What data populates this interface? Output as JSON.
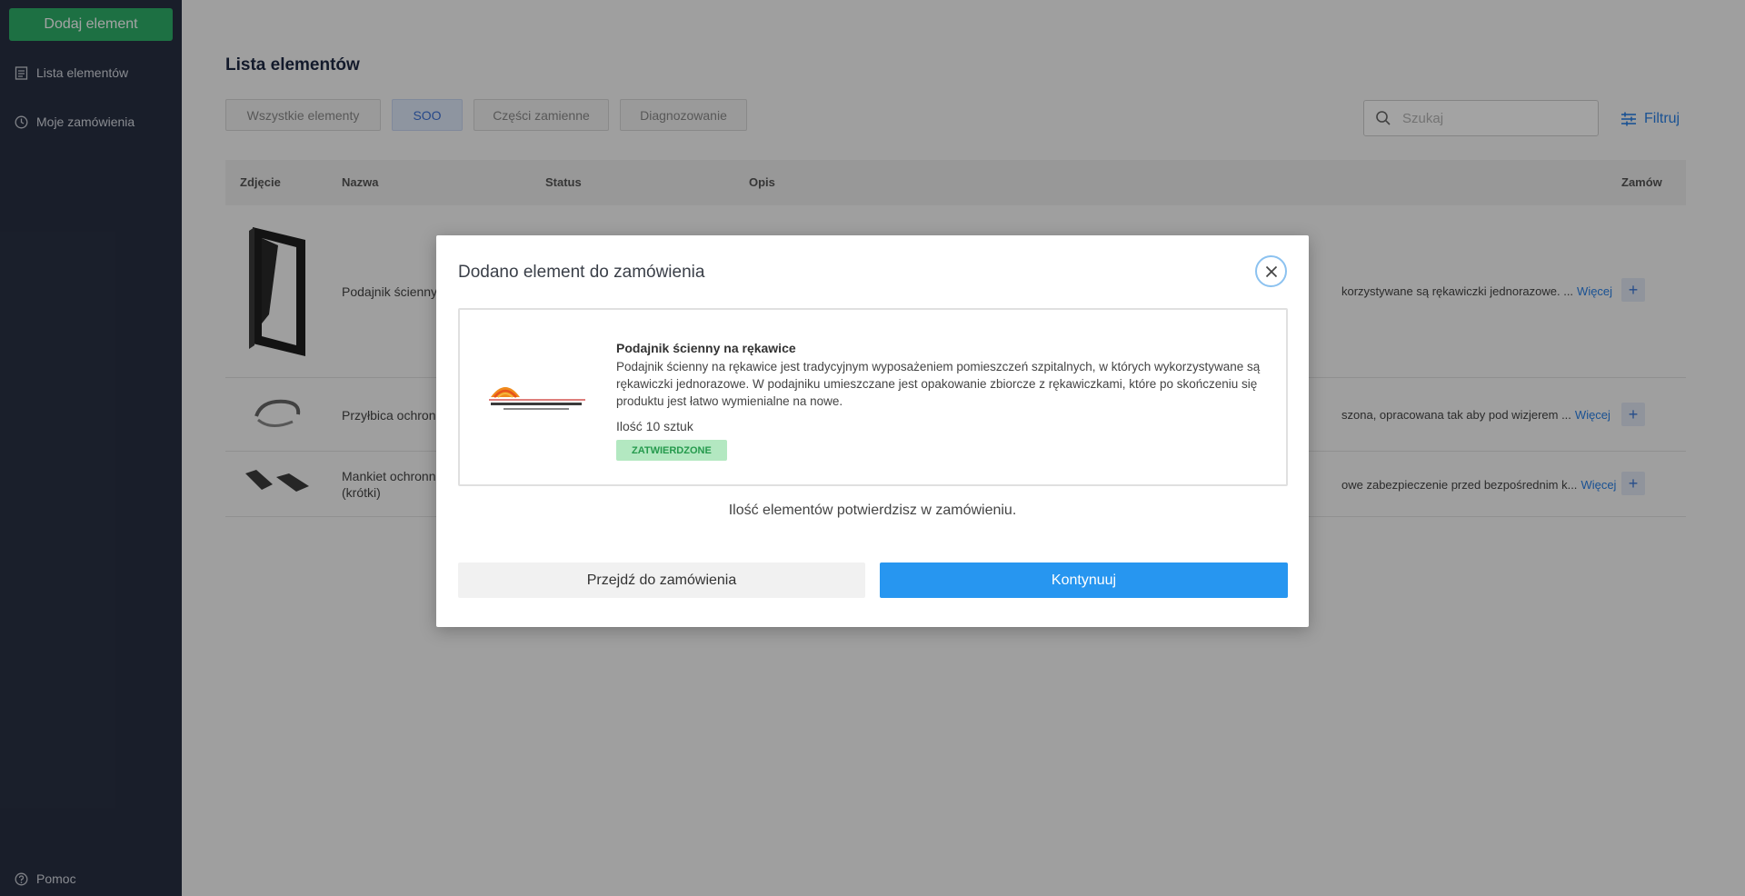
{
  "sidebar": {
    "add_button": "Dodaj element",
    "items": [
      {
        "label": "Lista elementów",
        "icon": "list-icon"
      },
      {
        "label": "Moje zamówienia",
        "icon": "clock-icon"
      }
    ],
    "help": {
      "label": "Pomoc",
      "icon": "help-icon"
    }
  },
  "main": {
    "title": "Lista elementów",
    "filters": [
      "Wszystkie elementy",
      "SOO",
      "Części zamienne",
      "Diagnozowanie"
    ],
    "active_filter": "SOO",
    "search_placeholder": "Szukaj",
    "filter_button": "Filtruj",
    "columns": [
      "Zdjęcie",
      "Nazwa",
      "Status",
      "Opis",
      "Zamów"
    ],
    "rows": [
      {
        "name": "Podajnik ścienny",
        "desc": "korzystywane są rękawiczki jednorazowe. ...",
        "more": "Więcej"
      },
      {
        "name": "Przyłbica ochronn",
        "desc": "szona, opracowana tak aby pod wizjerem ...",
        "more": "Więcej"
      },
      {
        "name": "Mankiet ochronn",
        "name2": "(krótki)",
        "desc": "owe zabezpieczenie przed bezpośrednim k...",
        "more": "Więcej"
      }
    ],
    "plus": "+"
  },
  "modal": {
    "title": "Dodano element do zamówienia",
    "item_name": "Podajnik ścienny na rękawice",
    "item_desc": "Podajnik ścienny na rękawice jest tradycyjnym wyposażeniem pomieszczeń szpitalnych, w których wykorzystywane są rękawiczki jednorazowe. W podajniku umieszczane jest opakowanie zbiorcze z rękawiczkami, które po skończeniu się produktu jest łatwo wymienialne na nowe.",
    "quantity": "Ilość 10 sztuk",
    "status": "ZATWIERDZONE",
    "note": "Ilość elementów potwierdzisz w zamówieniu.",
    "secondary_button": "Przejdź do zamówienia",
    "primary_button": "Kontynuuj"
  }
}
